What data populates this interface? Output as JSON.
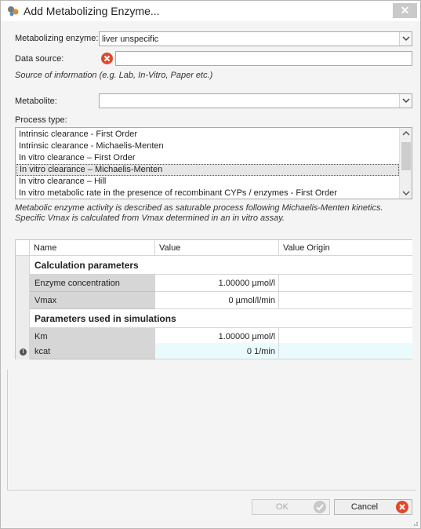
{
  "window": {
    "title": "Add Metabolizing Enzyme...",
    "close_glyph": "✕"
  },
  "form": {
    "enzyme_label": "Metabolizing enzyme:",
    "enzyme_value": "liver unspecific",
    "data_source_label": "Data source:",
    "data_source_value": "",
    "data_source_hint": "Source of information (e.g. Lab, In-Vitro, Paper etc.)",
    "metabolite_label": "Metabolite:",
    "metabolite_value": "",
    "process_type_label": "Process type:"
  },
  "process_types": [
    "Intrinsic clearance - First Order",
    "Intrinsic clearance - Michaelis-Menten",
    "In vitro clearance – First Order",
    "In vitro clearance – Michaelis-Menten",
    "In vitro clearance – Hill",
    "In vitro metabolic rate in the presence of recombinant CYPs / enzymes - First Order"
  ],
  "selected_process_index": 3,
  "description": "Metabolic enzyme activity is described as saturable process following Michaelis-Menten kinetics. Specific Vmax is calculated from Vmax determined in an in vitro assay.",
  "grid": {
    "columns": [
      "Name",
      "Value",
      "Value Origin"
    ],
    "groups": [
      {
        "title": "Calculation parameters",
        "rows": [
          {
            "name": "Enzyme concentration",
            "value": "1.00000 µmol/l",
            "origin": ""
          },
          {
            "name": "Vmax",
            "value": "0 µmol/l/min",
            "origin": ""
          }
        ]
      },
      {
        "title": "Parameters used in simulations",
        "rows": [
          {
            "name": "Km",
            "value": "1.00000 µmol/l",
            "origin": ""
          },
          {
            "name": "kcat",
            "value": "0 1/min",
            "origin": ""
          }
        ]
      }
    ],
    "info_glyph": "!"
  },
  "buttons": {
    "ok_label": "OK",
    "cancel_label": "Cancel"
  },
  "colors": {
    "error_red": "#e0482b",
    "ok_green_disabled": "#c8c8c8",
    "selected_row_bg": "#eafbfd"
  },
  "icons": {
    "app": "enzyme-app-icon",
    "error": "error-x-icon",
    "ok": "check-icon",
    "cancel": "cancel-x-icon",
    "info": "info-icon"
  }
}
